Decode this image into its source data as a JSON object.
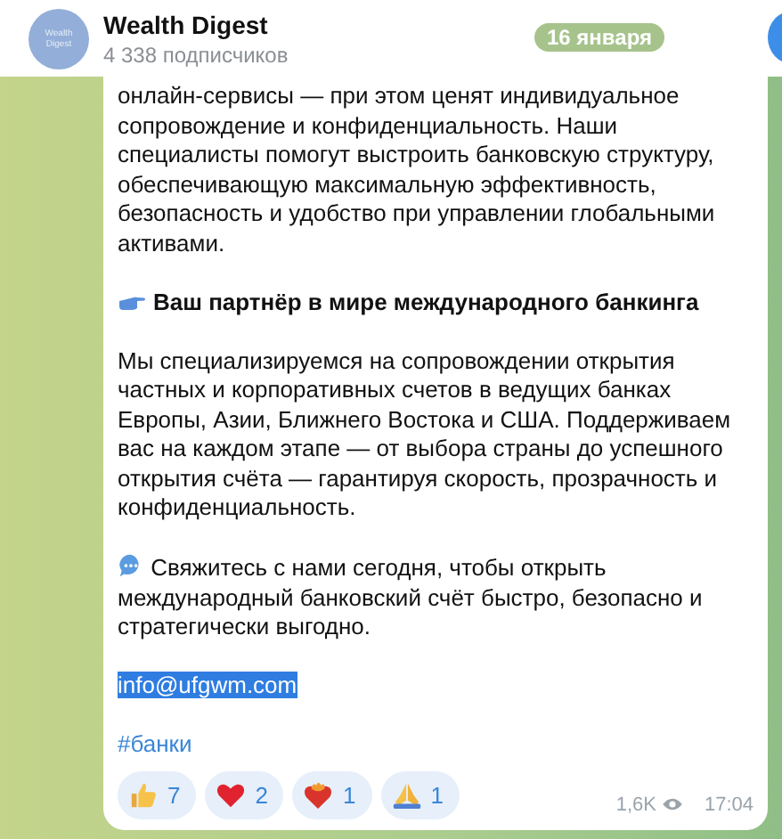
{
  "header": {
    "avatar_text": "Wealth Digest",
    "title": "Wealth Digest",
    "subtitle": "4 338 подписчиков"
  },
  "date_badge": "16 января",
  "message": {
    "paragraphs": [
      {
        "kind": "text",
        "text": "онлайн-сервисы — при этом ценят индивидуальное сопровождение и конфиденциальность. Наши специалисты помогут выстроить банковскую структуру, обеспечивающую максимальную эффективность, безопасность и удобство при управлении глобальными активами."
      },
      {
        "kind": "pointing",
        "text": "Ваш партнёр в мире международного банкинга"
      },
      {
        "kind": "text",
        "text": "Мы специализируемся на сопровождении открытия частных и корпоративных счетов в ведущих банках Европы, Азии, Ближнего Востока и США. Поддерживаем вас на каждом этапе — от выбора страны до успешного открытия счёта — гарантируя скорость, прозрачность и конфиденциальность."
      },
      {
        "kind": "speech",
        "text": "Свяжитесь с нами сегодня, чтобы открыть международный банковский счёт быстро, безопасно и стратегически выгодно."
      },
      {
        "kind": "email",
        "text": "info@ufgwm.com"
      },
      {
        "kind": "hashtag",
        "text": "#банки"
      }
    ],
    "reactions": [
      {
        "kind": "thumbs",
        "count": "7"
      },
      {
        "kind": "heart",
        "count": "2"
      },
      {
        "kind": "burning-heart",
        "count": "1"
      },
      {
        "kind": "pray",
        "count": "1"
      }
    ],
    "views": "1,6K",
    "time": "17:04"
  }
}
